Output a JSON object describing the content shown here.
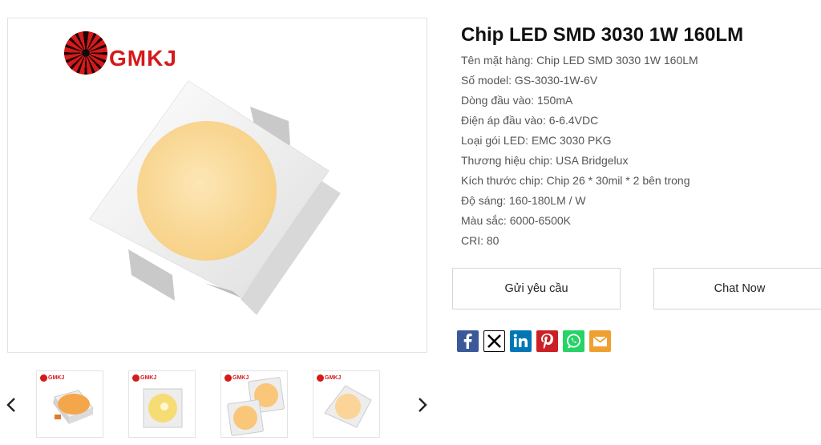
{
  "brand": {
    "logo_text": "GMKJ",
    "logo_color": "#d41a1a"
  },
  "product": {
    "title": "Chip LED SMD 3030 1W 160LM",
    "specs": [
      "Tên mặt hàng: Chip LED SMD 3030 1W 160LM",
      "Số model: GS-3030-1W-6V",
      "Dòng đầu vào: 150mA",
      "Điện áp đầu vào: 6-6.4VDC",
      "Loại gói LED: EMC 3030 PKG",
      "Thương hiệu chip: USA Bridgelux",
      "Kích thước chip: Chip 26 * 30mil * 2 bên trong",
      "Độ sáng: 160-180LM / W",
      "Màu sắc: 6000-6500K",
      "CRI: 80"
    ]
  },
  "gallery": {
    "prev_icon": "chevron-left-icon",
    "next_icon": "chevron-right-icon",
    "thumbnails": [
      {
        "name": "thumb-orange-chip",
        "logo": "GMKJ"
      },
      {
        "name": "thumb-yellow-chip",
        "logo": "GMKJ"
      },
      {
        "name": "thumb-two-chips",
        "logo": "GMKJ"
      },
      {
        "name": "thumb-angled-chip",
        "logo": "GMKJ"
      }
    ]
  },
  "actions": {
    "inquiry_label": "Gửi yêu cầu",
    "chat_label": "Chat Now"
  },
  "share": [
    {
      "icon": "facebook-icon",
      "color": "#3b5998"
    },
    {
      "icon": "x-twitter-icon",
      "color": "#000000"
    },
    {
      "icon": "linkedin-icon",
      "color": "#0077b5"
    },
    {
      "icon": "pinterest-icon",
      "color": "#cb2027"
    },
    {
      "icon": "whatsapp-icon",
      "color": "#25d366"
    },
    {
      "icon": "email-icon",
      "color": "#f0a030"
    }
  ]
}
